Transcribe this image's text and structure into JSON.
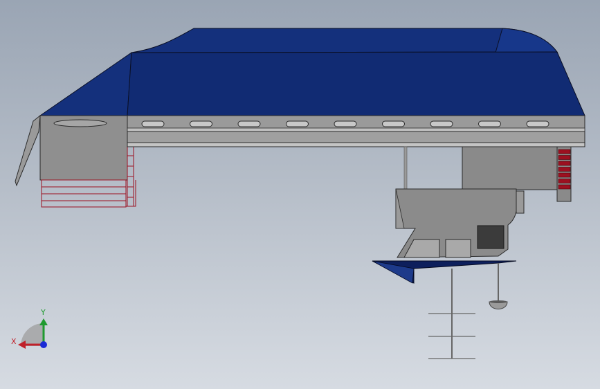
{
  "triad": {
    "x_label": "X",
    "y_label": "Y",
    "x_color": "#c0202a",
    "y_color": "#1f9a2f",
    "z_color": "#1b2bd6"
  },
  "colors": {
    "canopy": "#112b73",
    "canopy_light": "#193a8f",
    "body_gray": "#8e8e8e",
    "rail_gray": "#b4b4b4",
    "vent_red": "#9c1020",
    "fin_navy": "#0d1f5c",
    "window_gray": "#a8a8a8",
    "dark_box": "#3b3b3b"
  },
  "model": {
    "rail_slot_count": 9,
    "red_vent_count": 7,
    "ladder_rungs": 3
  }
}
